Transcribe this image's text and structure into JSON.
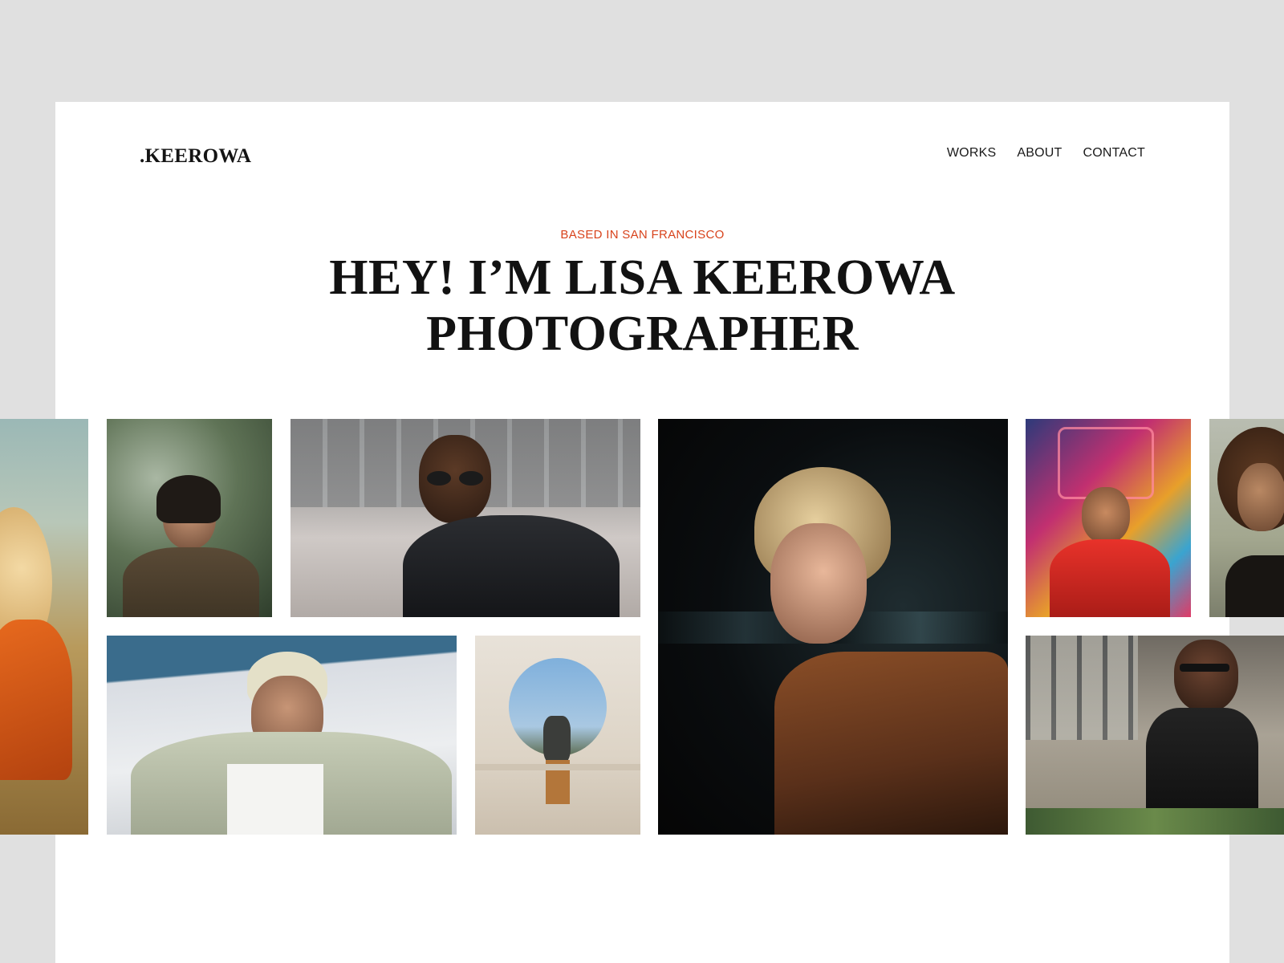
{
  "brand": {
    "logo": ".KEEROWA"
  },
  "nav": {
    "works": "WORKS",
    "about": "ABOUT",
    "contact": "CONTACT"
  },
  "hero": {
    "eyebrow": "BASED IN SAN FRANCISCO",
    "title_line1": "HEY! I’M LISA KEEROWA",
    "title_line2": "PHOTOGRAPHER"
  },
  "colors": {
    "accent": "#d8431c",
    "page_background": "#e0e0e0",
    "card_background": "#ffffff",
    "text": "#121212"
  }
}
